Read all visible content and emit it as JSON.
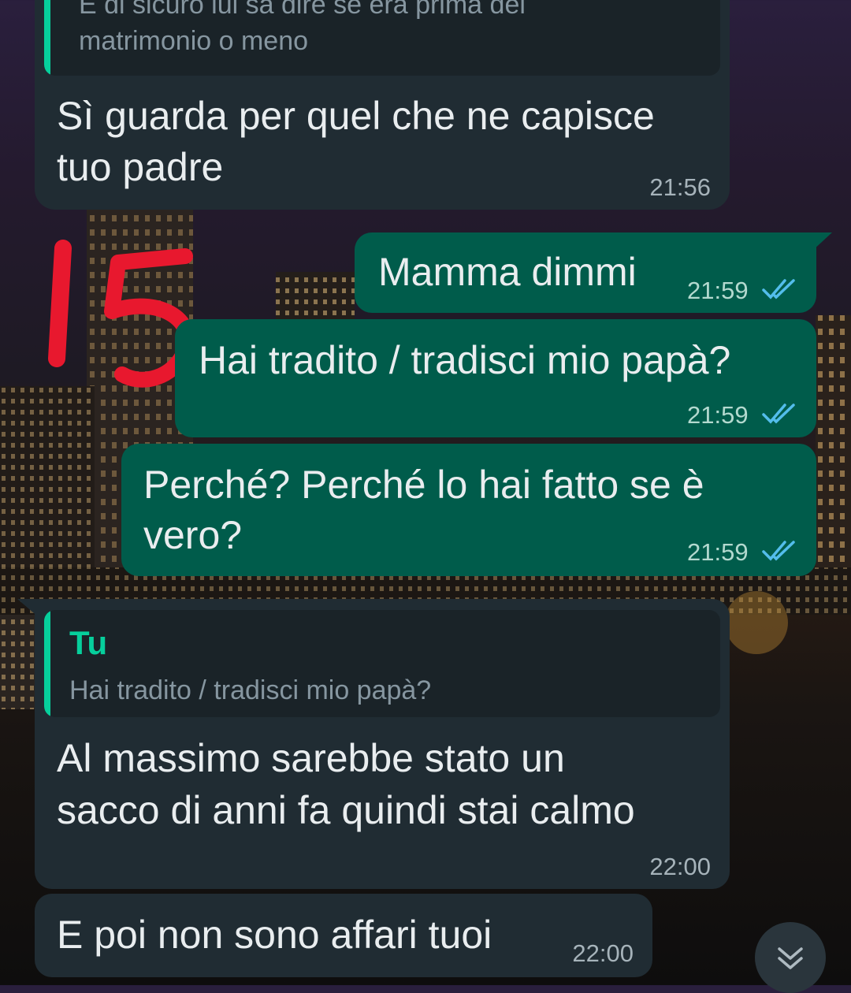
{
  "messages": [
    {
      "quote_text_1": "E di sicuro lui sa dire se era prima del",
      "quote_text_2": "matrimonio o meno",
      "text_1": "Sì guarda per quel che ne capisce",
      "text_2": "tuo padre",
      "time": "21:56"
    },
    {
      "text": "Mamma dimmi",
      "time": "21:59"
    },
    {
      "text": "Hai tradito / tradisci mio papà?",
      "time": "21:59"
    },
    {
      "text_1": "Perché? Perché lo hai fatto se è",
      "text_2": "vero?",
      "time": "21:59"
    },
    {
      "quote_author": "Tu",
      "quote_text": "Hai tradito / tradisci mio papà?",
      "text_1": "Al massimo sarebbe stato un",
      "text_2": "sacco di anni fa quindi stai calmo",
      "time": "22:00"
    },
    {
      "text": "E poi non sono affari tuoi",
      "time": "22:00"
    }
  ],
  "annotation": "15",
  "icons": {
    "read_receipt": "double-check-icon",
    "scroll_down": "chevron-double-down-icon"
  },
  "colors": {
    "incoming": "#202c33",
    "outgoing": "#005c4b",
    "quote_accent": "#06cf9c",
    "annotation": "#e8182e"
  }
}
